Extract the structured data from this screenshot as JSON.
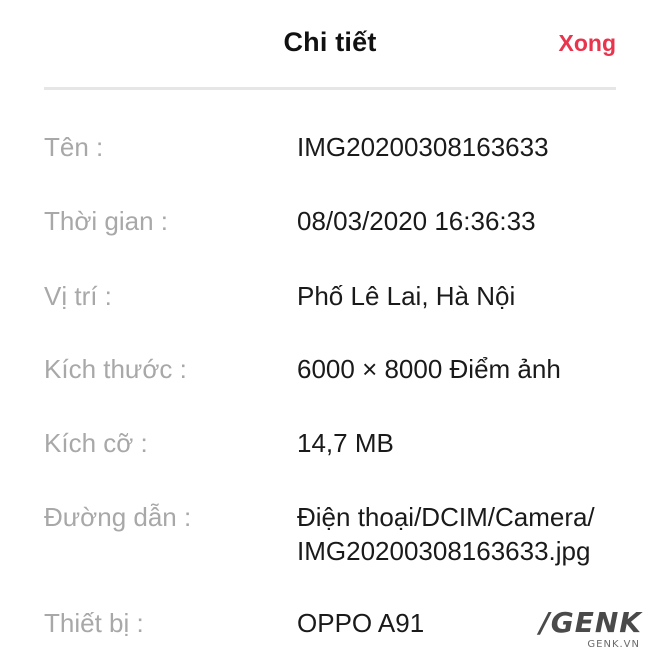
{
  "header": {
    "title": "Chi tiết",
    "done_label": "Xong",
    "done_color": "#e8354d"
  },
  "details": {
    "name": {
      "label": "Tên :",
      "value": "IMG20200308163633"
    },
    "time": {
      "label": "Thời gian :",
      "value": "08/03/2020 16:36:33"
    },
    "location": {
      "label": "Vị trí :",
      "value": "Phố Lê Lai, Hà Nội"
    },
    "dimensions": {
      "label": "Kích thước :",
      "value": "6000 × 8000 Điểm ảnh"
    },
    "size": {
      "label": "Kích cỡ :",
      "value": "14,7 MB"
    },
    "path": {
      "label": "Đường dẫn :",
      "value_line1": "Điện thoại/DCIM/Camera/",
      "value_line2": "IMG20200308163633.jpg"
    },
    "device": {
      "label": "Thiết bị :",
      "value": "OPPO A91"
    }
  },
  "watermark": {
    "logo": "/GENK",
    "site": "GENK.VN"
  }
}
